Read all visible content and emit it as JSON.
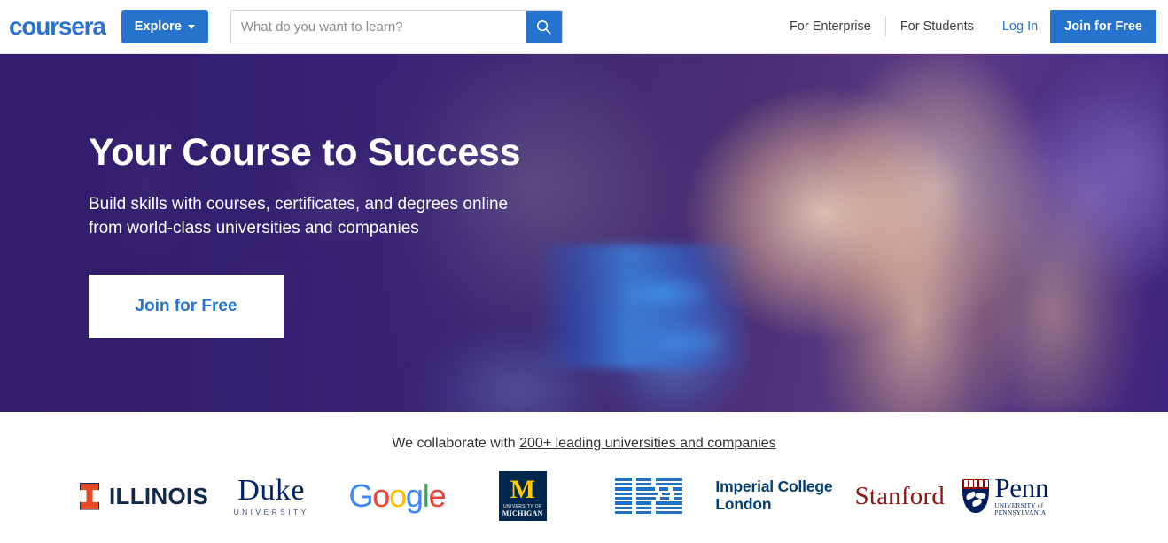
{
  "header": {
    "logo_text": "coursera",
    "logo_icon": "coursera-wordmark",
    "explore_label": "Explore",
    "explore_caret_icon": "chevron-down-icon",
    "search": {
      "placeholder": "What do you want to learn?",
      "value": "",
      "button_icon": "search-icon"
    },
    "nav": [
      {
        "label": "For Enterprise",
        "name": "for-enterprise"
      },
      {
        "label": "For Students",
        "name": "for-students"
      },
      {
        "label": "Log In",
        "name": "log-in"
      }
    ],
    "join_label": "Join for Free",
    "accent_color": "#2573cc"
  },
  "hero": {
    "title": "Your Course to Success",
    "subtitle": "Build skills with courses, certificates, and degrees online from world-class universities and companies",
    "cta_label": "Join for Free",
    "background_color": "#3a2478",
    "cta_text_color": "#2573cc",
    "image_description": "Woman examining a blue robotic mechanical component"
  },
  "partners": {
    "collab_prefix": "We collaborate with ",
    "collab_link": "200+ leading universities and companies",
    "logos": [
      {
        "name": "illinois",
        "text": "ILLINOIS",
        "mark": "block-I",
        "color": "#13294b",
        "accent": "#e84a27"
      },
      {
        "name": "duke",
        "text": "Duke",
        "subtext": "UNIVERSITY",
        "color": "#012169"
      },
      {
        "name": "google",
        "letters": [
          "G",
          "o",
          "o",
          "g",
          "l",
          "e"
        ],
        "colors": [
          "#4285f4",
          "#ea4335",
          "#fbbc05",
          "#4285f4",
          "#34a853",
          "#ea4335"
        ]
      },
      {
        "name": "michigan",
        "mark": "M",
        "line1": "UNIVERSITY OF",
        "line2": "MICHIGAN",
        "color": "#00274c",
        "accent": "#ffcb05"
      },
      {
        "name": "ibm",
        "text": "IBM",
        "color": "#1f70c1"
      },
      {
        "name": "imperial-college-london",
        "line1": "Imperial College",
        "line2": "London",
        "color": "#003e74"
      },
      {
        "name": "stanford",
        "text": "Stanford",
        "color": "#8c1515"
      },
      {
        "name": "penn",
        "text": "Penn",
        "subtext": "UNIVERSITY of PENNSYLVANIA",
        "mark": "shield-crest",
        "color": "#011f5b"
      }
    ]
  }
}
